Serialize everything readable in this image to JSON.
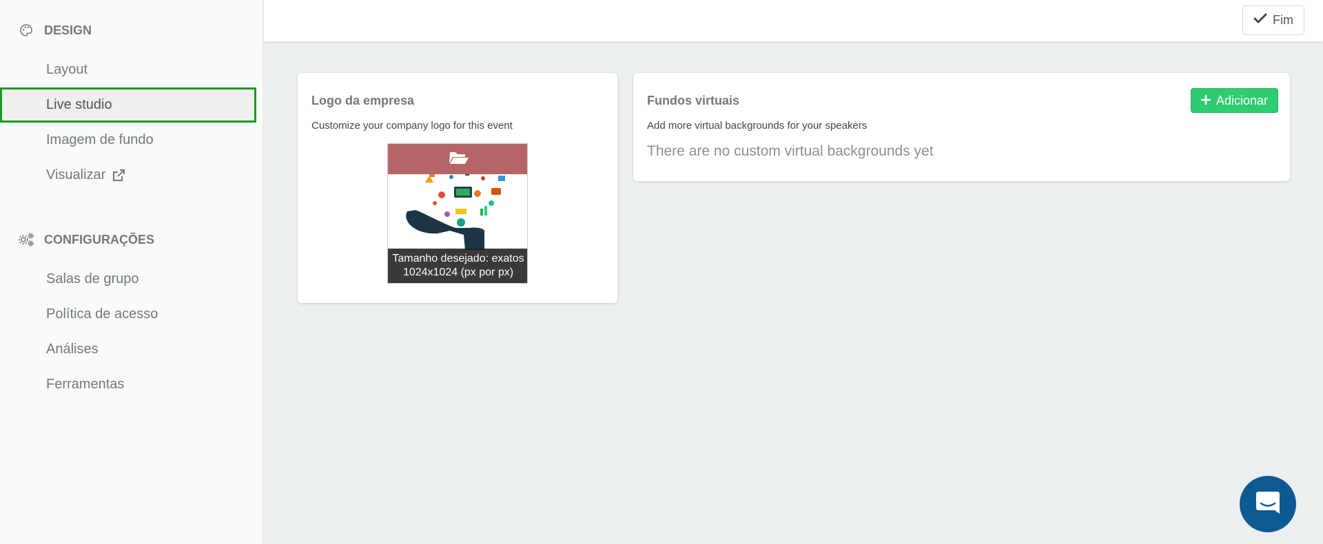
{
  "sidebar": {
    "design": {
      "title": "DESIGN",
      "icon": "palette-icon",
      "items": [
        {
          "label": "Layout"
        },
        {
          "label": "Live studio",
          "active": true
        },
        {
          "label": "Imagem de fundo"
        },
        {
          "label": "Visualizar",
          "icon": "external-link-icon"
        }
      ]
    },
    "config": {
      "title": "CONFIGURAÇÕES",
      "icon": "gears-icon",
      "items": [
        {
          "label": "Salas de grupo"
        },
        {
          "label": "Política de acesso"
        },
        {
          "label": "Análises"
        },
        {
          "label": "Ferramentas"
        }
      ]
    }
  },
  "topbar": {
    "fim_label": "Fim",
    "fim_icon": "check-icon"
  },
  "logo_card": {
    "title": "Logo da empresa",
    "subtitle": "Customize your company logo for this event",
    "caption_line1": "Tamanho desejado: exatos",
    "caption_line2": "1024x1024 (px por px)",
    "upload_icon": "folder-open-icon"
  },
  "backgrounds_card": {
    "title": "Fundos virtuais",
    "subtitle": "Add more virtual backgrounds for your speakers",
    "empty_message": "There are no custom virtual backgrounds yet",
    "add_label": "Adicionar",
    "add_icon": "plus-icon"
  },
  "colors": {
    "accent_green": "#2ecc71",
    "active_border": "#1a9a22",
    "chat_blue": "#0d5a93"
  },
  "chat": {
    "icon": "chat-icon"
  }
}
